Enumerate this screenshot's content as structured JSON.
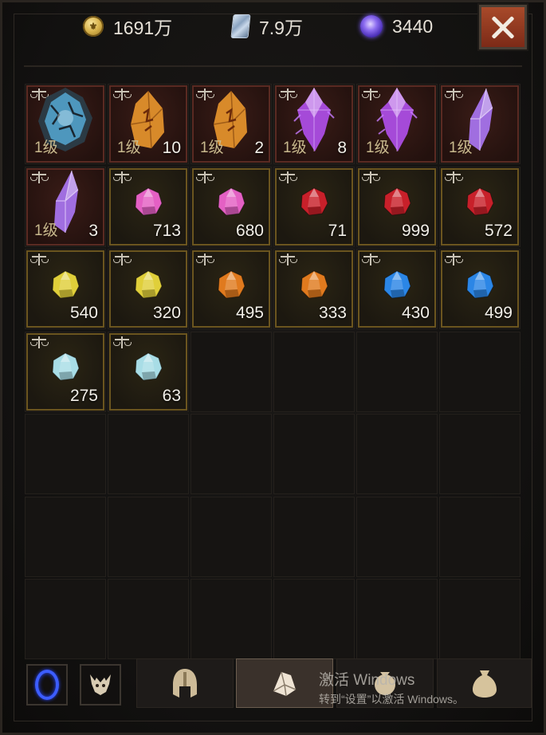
{
  "currency": {
    "gold": {
      "icon": "gold-coin-icon",
      "value": "1691万"
    },
    "silver": {
      "icon": "silver-scroll-icon",
      "value": "7.9万"
    },
    "gem": {
      "icon": "purple-orb-icon",
      "value": "3440"
    }
  },
  "close_button": {
    "icon": "close-icon"
  },
  "items": [
    {
      "kind": "rune",
      "color": "#5bb7e6",
      "shape": "rock",
      "level": "1级",
      "qty": ""
    },
    {
      "kind": "rune",
      "color": "#d88a2a",
      "shape": "rune",
      "level": "1级",
      "qty": "10"
    },
    {
      "kind": "rune",
      "color": "#d88a2a",
      "shape": "rune",
      "level": "1级",
      "qty": "2"
    },
    {
      "kind": "rune",
      "color": "#a54ad8",
      "shape": "crystal",
      "level": "1级",
      "qty": "8"
    },
    {
      "kind": "rune",
      "color": "#a54ad8",
      "shape": "crystal",
      "level": "1级",
      "qty": ""
    },
    {
      "kind": "rune",
      "color": "#a06ee0",
      "shape": "shard",
      "level": "1级",
      "qty": ""
    },
    {
      "kind": "rune",
      "color": "#a06ee0",
      "shape": "shard",
      "level": "1级",
      "qty": "3"
    },
    {
      "kind": "gem",
      "color": "#e460c4",
      "shape": "gem",
      "level": "",
      "qty": "713"
    },
    {
      "kind": "gem",
      "color": "#e460c4",
      "shape": "gem",
      "level": "",
      "qty": "680"
    },
    {
      "kind": "gem",
      "color": "#c8202a",
      "shape": "gem",
      "level": "",
      "qty": "71"
    },
    {
      "kind": "gem",
      "color": "#c8202a",
      "shape": "gem",
      "level": "",
      "qty": "999"
    },
    {
      "kind": "gem",
      "color": "#c8202a",
      "shape": "gem",
      "level": "",
      "qty": "572"
    },
    {
      "kind": "gem",
      "color": "#e0cf3a",
      "shape": "gem",
      "level": "",
      "qty": "540"
    },
    {
      "kind": "gem",
      "color": "#e0cf3a",
      "shape": "gem",
      "level": "",
      "qty": "320"
    },
    {
      "kind": "gem",
      "color": "#e07a1e",
      "shape": "gem",
      "level": "",
      "qty": "495"
    },
    {
      "kind": "gem",
      "color": "#e07a1e",
      "shape": "gem",
      "level": "",
      "qty": "333"
    },
    {
      "kind": "gem",
      "color": "#2b86e6",
      "shape": "gem",
      "level": "",
      "qty": "430"
    },
    {
      "kind": "gem",
      "color": "#2b86e6",
      "shape": "gem",
      "level": "",
      "qty": "499"
    },
    {
      "kind": "gem",
      "color": "#a8dde6",
      "shape": "gem",
      "level": "",
      "qty": "275"
    },
    {
      "kind": "gem",
      "color": "#a8dde6",
      "shape": "gem",
      "level": "",
      "qty": "63"
    }
  ],
  "tabs": [
    {
      "name": "tab-ring",
      "icon": "blue-ring-icon"
    },
    {
      "name": "tab-demon",
      "icon": "demon-head-icon"
    },
    {
      "name": "tab-helmet",
      "icon": "helmet-icon"
    },
    {
      "name": "tab-gems",
      "icon": "gem-pile-icon",
      "active": true
    },
    {
      "name": "tab-bag",
      "icon": "loot-bag-icon"
    },
    {
      "name": "tab-sack",
      "icon": "money-sack-icon"
    }
  ],
  "watermark": {
    "line1": "激活 Windows",
    "line2": "转到“设置”以激活 Windows。"
  }
}
